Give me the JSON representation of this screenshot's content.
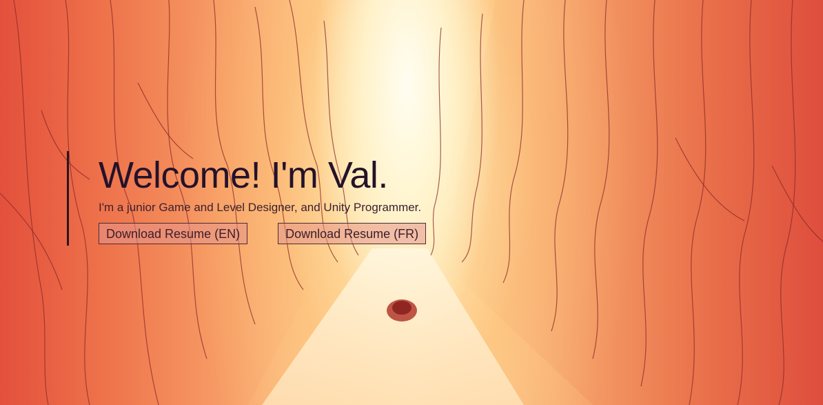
{
  "hero": {
    "title": "Welcome! I'm Val.",
    "subtitle": "I'm a junior Game and Level Designer, and Unity Programmer.",
    "buttons": [
      {
        "label": "Download Resume (EN)"
      },
      {
        "label": "Download Resume (FR)"
      }
    ]
  },
  "colors": {
    "accent_bar": "#2a1420",
    "title_text": "#24122a",
    "button_bg": "#e6968c",
    "canyon_left": "#e85a3e",
    "canyon_center": "#fff3d6"
  },
  "background": {
    "description_icon": "canyon-illustration"
  }
}
